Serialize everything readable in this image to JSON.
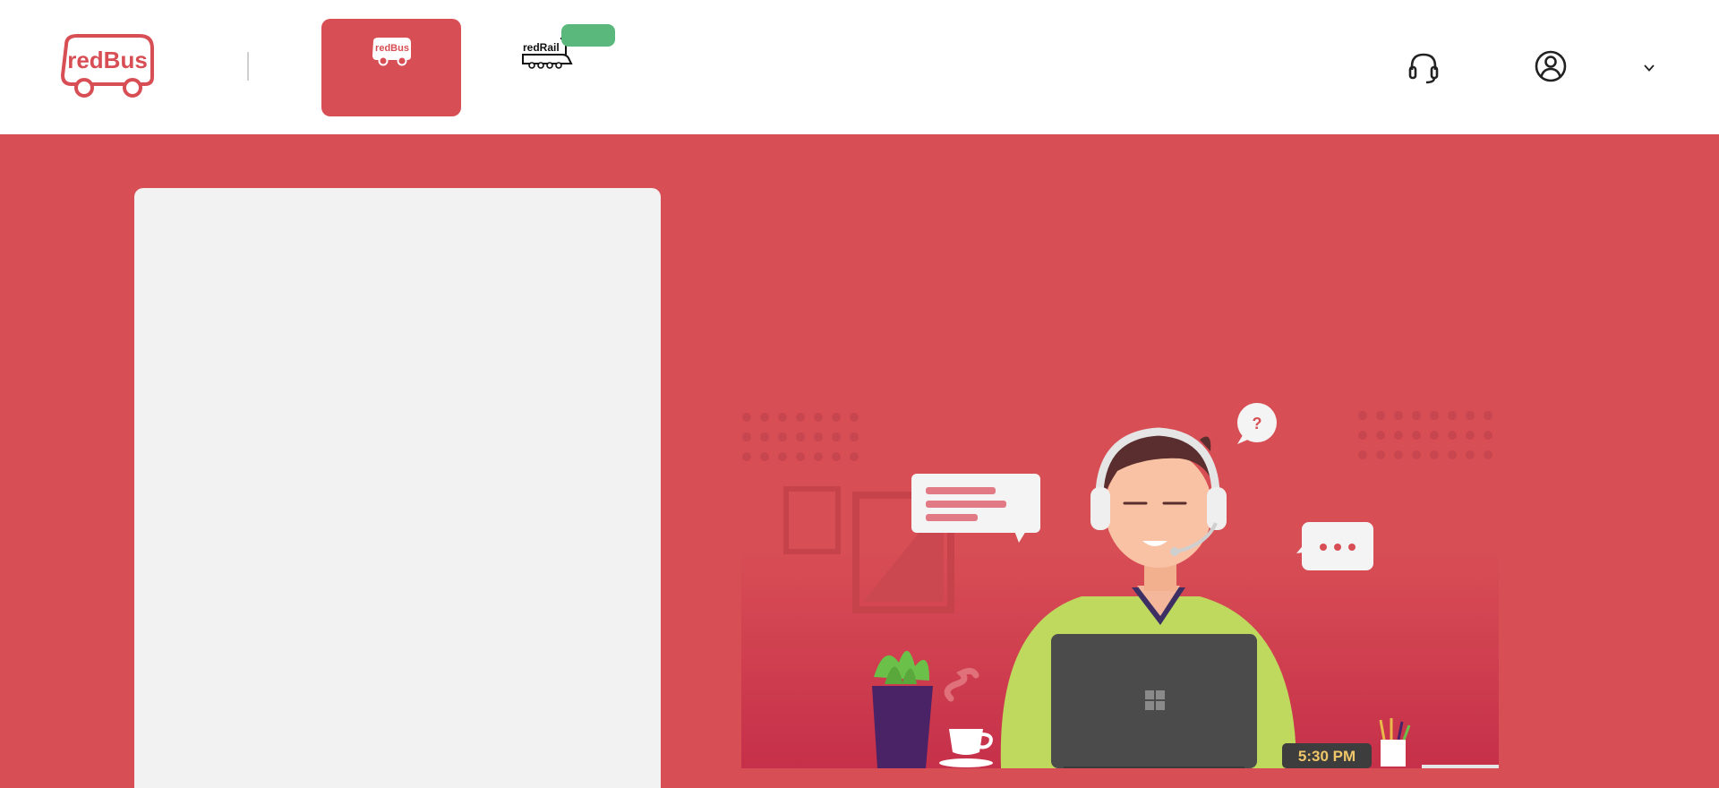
{
  "brand": {
    "name": "redBus",
    "color": "#d84e55"
  },
  "tabs": [
    {
      "id": "bus",
      "logo_text": "redBus",
      "label": "",
      "active": true
    },
    {
      "id": "rail",
      "logo_text": "redRail",
      "label": "",
      "badge": "",
      "active": false
    }
  ],
  "header": {
    "help_icon": "headset-icon",
    "account_icon": "user-circle-icon",
    "account_label": "",
    "dropdown_icon": "chevron-down-icon"
  },
  "illustration": {
    "time_label": "5:30 PM",
    "question_mark": "?"
  },
  "colors": {
    "header_bg": "#ffffff",
    "page_bg": "#d84e55",
    "card_bg": "#f2f2f2",
    "badge_green": "#5bb87d"
  }
}
